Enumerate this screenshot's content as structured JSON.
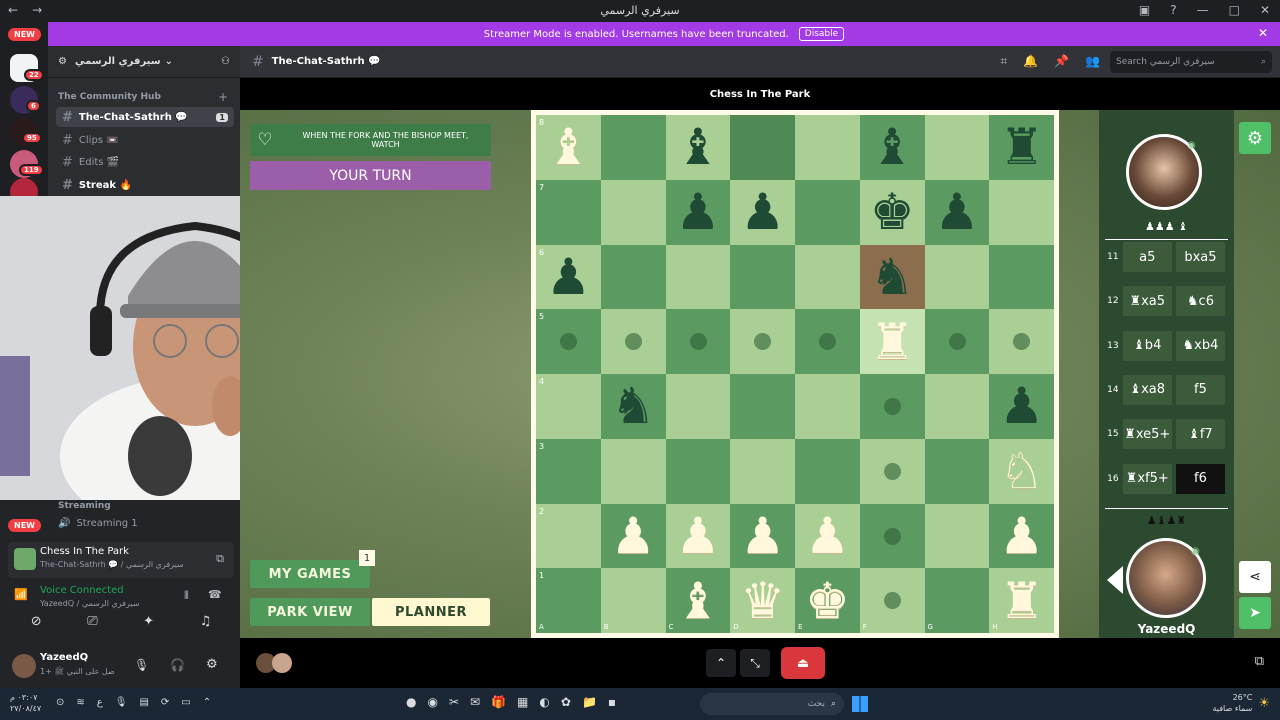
{
  "window": {
    "title": "سيرفري الرسمي"
  },
  "banner": {
    "text": "Streamer Mode is enabled. Usernames have been truncated.",
    "disable_label": "Disable"
  },
  "rail": {
    "new_label": "NEW",
    "badges": [
      "22",
      "6",
      "95",
      "119"
    ]
  },
  "sidebar": {
    "server_name": "سيرفري الرسمي",
    "category": "The Community Hub",
    "channels": [
      {
        "label": "The-Chat-Sathrh 💬",
        "selected": true
      },
      {
        "label": "Clips 📼",
        "selected": false
      },
      {
        "label": "Edits 🎬",
        "selected": false
      },
      {
        "label": "Streak 🔥",
        "selected": false
      }
    ],
    "streaming_category": "Streaming",
    "streaming_channel": "Streaming 1",
    "new_label": "NEW"
  },
  "activity_card": {
    "title": "Chess In The Park",
    "subtitle": "The-Chat-Sathrh 💬 / سيرفري الرسمي"
  },
  "voice": {
    "status": "Voice Connected",
    "detail": "YazeedQ / سيرفري الرسمي"
  },
  "user": {
    "name": "YazeedQ",
    "status": "صل على النبي ﷺ +1"
  },
  "header": {
    "channel": "The-Chat-Sathrh 💬",
    "search_placeholder": "Search سيرفري الرسمي"
  },
  "activity": {
    "title": "Chess In The Park"
  },
  "game": {
    "prompt": "WHEN THE FORK AND THE BISHOP MEET, WATCH",
    "turn": "YOUR TURN",
    "my_games": "MY GAMES",
    "my_games_count": "1",
    "park_view": "PARK VIEW",
    "planner": "PLANNER",
    "files": [
      "A",
      "B",
      "C",
      "D",
      "E",
      "F",
      "G",
      "H"
    ],
    "ranks": [
      "8",
      "7",
      "6",
      "5",
      "4",
      "3",
      "2",
      "1"
    ]
  },
  "opponent": {
    "captured": "♟♟♟ ♝"
  },
  "player": {
    "name": "YazeedQ",
    "captured": "♟♝♟♜"
  },
  "moves": [
    {
      "n": "11",
      "w": "a5",
      "b": "bxa5",
      "hl": false
    },
    {
      "n": "12",
      "w": "♜xa5",
      "b": "♞c6",
      "hl": false
    },
    {
      "n": "13",
      "w": "♝b4",
      "b": "♞xb4",
      "hl": false
    },
    {
      "n": "14",
      "w": "♝xa8",
      "b": "f5",
      "hl": false
    },
    {
      "n": "15",
      "w": "♜xe5+",
      "b": "♝f7",
      "hl": false
    },
    {
      "n": "16",
      "w": "♜xf5+",
      "b": "f6",
      "hl": true
    }
  ],
  "taskbar": {
    "time": "٠٣:٠٧ م",
    "date": "٢٧/٠٨/٤٧",
    "weather_temp": "26°C",
    "weather_text": "سماء صافية",
    "search_placeholder": "بحث"
  },
  "colors": {
    "accent": "#a23be5",
    "board_light": "#a9cf95",
    "board_dark": "#5b9b62",
    "danger": "#f23f43"
  }
}
